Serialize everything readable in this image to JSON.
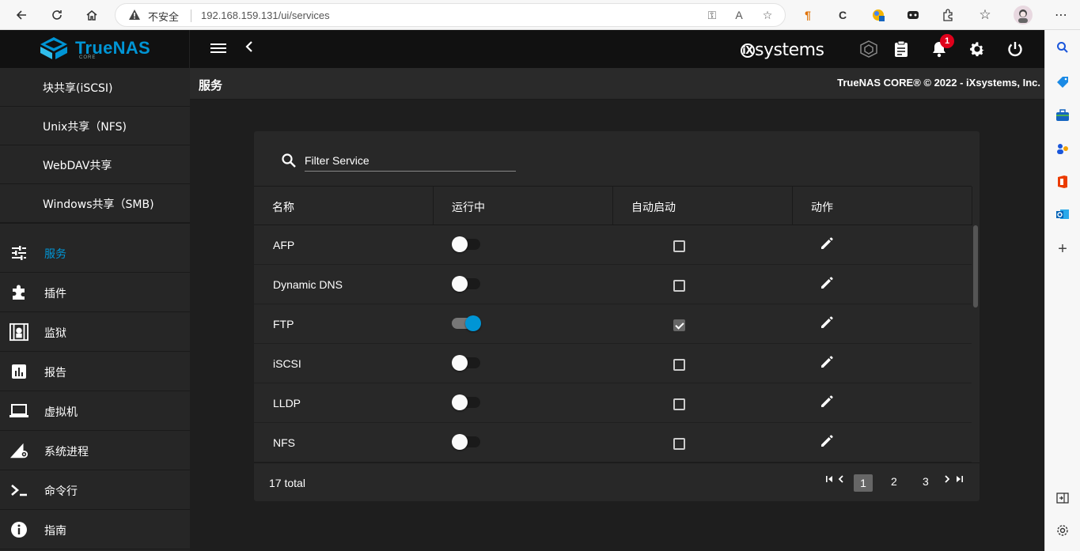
{
  "browser": {
    "insecure_label": "不安全",
    "url": "192.168.159.131/ui/services"
  },
  "header": {
    "logo": "TrueNAS",
    "logo_sub": "CORE",
    "brand": "iXsystems",
    "notification_count": "1"
  },
  "subheader": {
    "title": "服务",
    "copyright": "TrueNAS CORE® © 2022 - iXsystems, Inc."
  },
  "sidebar": {
    "sub_items": [
      {
        "label": "块共享(iSCSI)"
      },
      {
        "label": "Unix共享（NFS)"
      },
      {
        "label": "WebDAV共享"
      },
      {
        "label": "Windows共享（SMB)"
      }
    ],
    "items": [
      {
        "label": "服务",
        "icon": "tune-icon",
        "active": true
      },
      {
        "label": "插件",
        "icon": "puzzle-icon"
      },
      {
        "label": "监狱",
        "icon": "jail-icon"
      },
      {
        "label": "报告",
        "icon": "chart-icon"
      },
      {
        "label": "虚拟机",
        "icon": "laptop-icon"
      },
      {
        "label": "系统进程",
        "icon": "system-process-icon"
      },
      {
        "label": "命令行",
        "icon": "terminal-icon"
      },
      {
        "label": "指南",
        "icon": "info-icon"
      }
    ]
  },
  "table": {
    "filter_placeholder": "Filter Service",
    "columns": [
      "名称",
      "运行中",
      "自动启动",
      "动作"
    ],
    "rows": [
      {
        "name": "AFP",
        "running": false,
        "autostart": false
      },
      {
        "name": "Dynamic DNS",
        "running": false,
        "autostart": false
      },
      {
        "name": "FTP",
        "running": true,
        "autostart": true
      },
      {
        "name": "iSCSI",
        "running": false,
        "autostart": false
      },
      {
        "name": "LLDP",
        "running": false,
        "autostart": false
      },
      {
        "name": "NFS",
        "running": false,
        "autostart": false
      }
    ],
    "total": "17 total",
    "pages": [
      "1",
      "2",
      "3"
    ],
    "current_page": "1"
  },
  "colors": {
    "accent": "#0095d5",
    "badge": "#e0001b"
  }
}
